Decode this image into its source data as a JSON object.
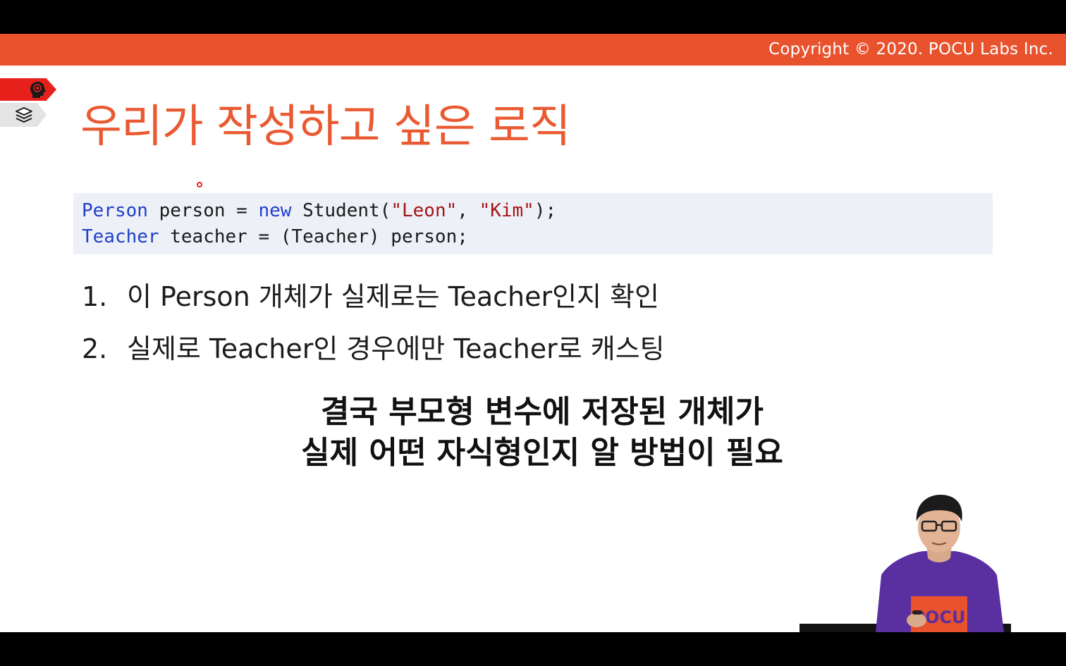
{
  "banner": {
    "copyright": "Copyright © 2020. POCU Labs Inc."
  },
  "side_tabs": {
    "active_icon": "brain-head-icon",
    "inactive_icon": "book-stack-icon"
  },
  "slide": {
    "title": "우리가 작성하고 싶은 로직",
    "code": {
      "line1": {
        "type": "Person",
        "rest1": " person = ",
        "kw_new": "new",
        "rest2": " Student(",
        "arg1": "\"Leon\"",
        "comma": ", ",
        "arg2": "\"Kim\"",
        "end": ");"
      },
      "line2": {
        "type": "Teacher",
        "rest": " teacher = (Teacher) person;"
      }
    },
    "list": [
      {
        "num": "1.",
        "text": "이 Person 개체가 실제로는 Teacher인지 확인"
      },
      {
        "num": "2.",
        "text": "실제로 Teacher인 경우에만 Teacher로 캐스팅"
      }
    ],
    "conclusion": {
      "line1": "결국 부모형 변수에 저장된 개체가",
      "line2": "실제 어떤 자식형인지 알 방법이 필요"
    },
    "presenter_shirt_text": "POCU"
  },
  "colors": {
    "banner": "#e8522d",
    "title": "#ea5a32",
    "active_tab": "#e8201c",
    "code_bg": "#eef0f8",
    "keyword": "#1f3fc8",
    "string": "#a31515"
  }
}
